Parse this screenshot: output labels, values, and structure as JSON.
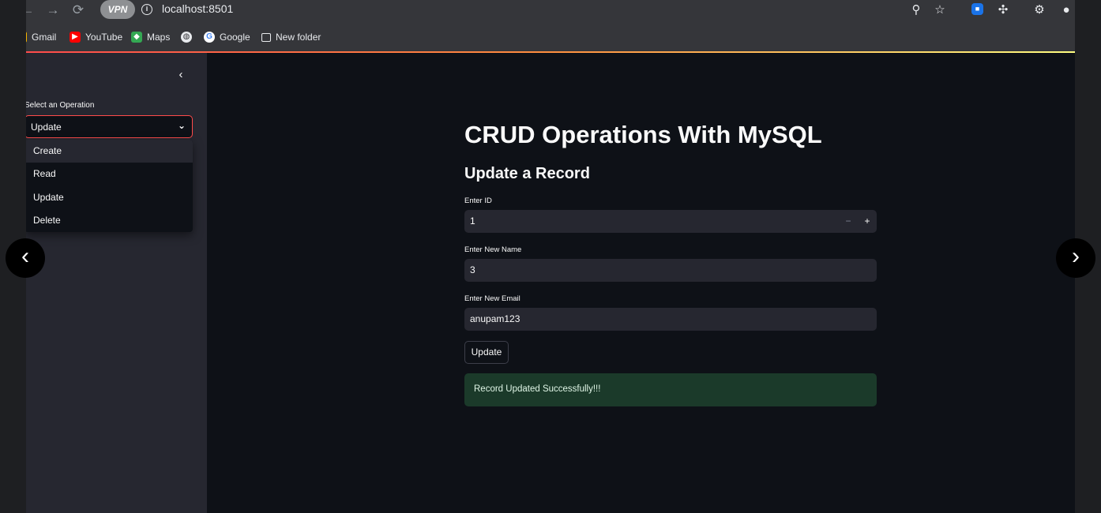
{
  "browser": {
    "url": "localhost:8501",
    "vpn_label": "VPN",
    "bookmarks": [
      {
        "label": "Gmail",
        "icon": "gmail-icon"
      },
      {
        "label": "YouTube",
        "icon": "youtube-icon"
      },
      {
        "label": "Maps",
        "icon": "maps-icon"
      },
      {
        "label": "",
        "icon": "globe-icon"
      },
      {
        "label": "Google",
        "icon": "google-icon"
      },
      {
        "label": "New folder",
        "icon": "folder-icon"
      }
    ]
  },
  "sidebar": {
    "select_label": "Select an Operation",
    "selected": "Update",
    "options": [
      "Create",
      "Read",
      "Update",
      "Delete"
    ]
  },
  "main": {
    "title": "CRUD Operations With MySQL",
    "section_title": "Update a Record",
    "fields": [
      {
        "label": "Enter ID",
        "value": "1"
      },
      {
        "label": "Enter New Name",
        "value": "3"
      },
      {
        "label": "Enter New Email",
        "value": "anupam123"
      }
    ],
    "stepper_minus": "−",
    "stepper_plus": "+",
    "button_label": "Update",
    "success_message": "Record Updated Successfully!!!"
  },
  "colors": {
    "accent": "#ff4b4b",
    "success_bg": "#1b3a2a",
    "sidebar_bg": "#262730",
    "main_bg": "#0e1117"
  }
}
